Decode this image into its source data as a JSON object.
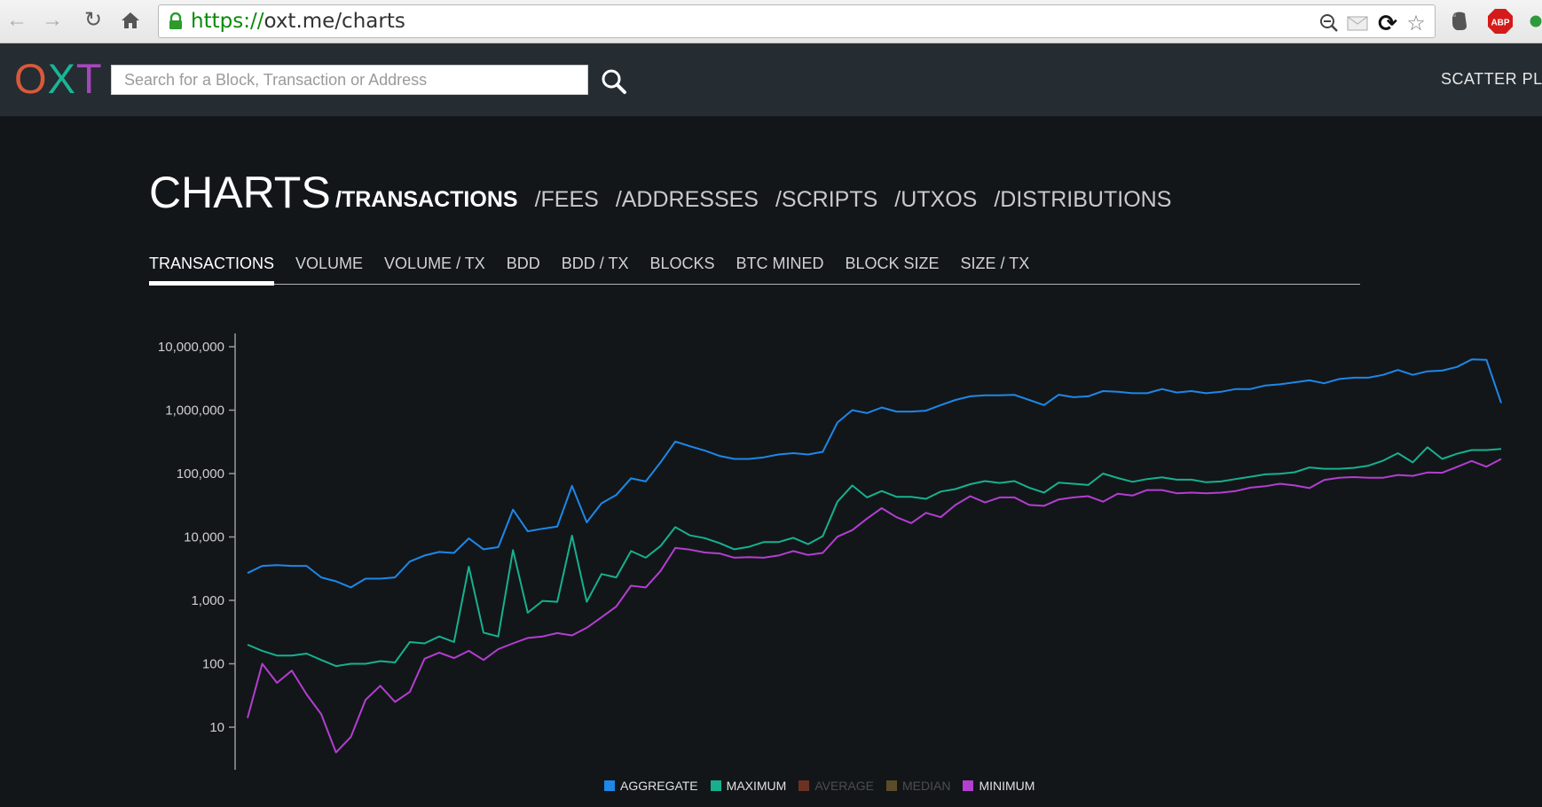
{
  "browser": {
    "url_scheme": "https://",
    "url_rest": "oxt.me/charts"
  },
  "header": {
    "logo": {
      "o": "O",
      "x": "X",
      "t": "T"
    },
    "search_placeholder": "Search for a Block, Transaction or Address",
    "scatter_link": "SCATTER PLO"
  },
  "page": {
    "title": "CHARTS",
    "sections": [
      {
        "label": "/TRANSACTIONS",
        "active": true
      },
      {
        "label": "/FEES",
        "active": false
      },
      {
        "label": "/ADDRESSES",
        "active": false
      },
      {
        "label": "/SCRIPTS",
        "active": false
      },
      {
        "label": "/UTXOS",
        "active": false
      },
      {
        "label": "/DISTRIBUTIONS",
        "active": false
      }
    ],
    "tabs": [
      {
        "label": "TRANSACTIONS",
        "active": true
      },
      {
        "label": "VOLUME",
        "active": false
      },
      {
        "label": "VOLUME / TX",
        "active": false
      },
      {
        "label": "BDD",
        "active": false
      },
      {
        "label": "BDD / TX",
        "active": false
      },
      {
        "label": "BLOCKS",
        "active": false
      },
      {
        "label": "BTC MINED",
        "active": false
      },
      {
        "label": "BLOCK SIZE",
        "active": false
      },
      {
        "label": "SIZE / TX",
        "active": false
      }
    ]
  },
  "chart_data": {
    "type": "line",
    "yscale": "log",
    "ylim": [
      4,
      10000000
    ],
    "y_ticks": [
      10000000,
      1000000,
      100000,
      10000,
      1000,
      100,
      10
    ],
    "y_tick_labels": [
      "10,000,000",
      "1,000,000",
      "100,000",
      "10,000",
      "1,000",
      "100",
      "10"
    ],
    "legend_position": "bottom-center",
    "series": [
      {
        "name": "AGGREGATE",
        "color": "#1e87e8",
        "enabled": true,
        "values": [
          2700,
          3500,
          3600,
          3500,
          3500,
          2300,
          2000,
          1600,
          2200,
          2200,
          2300,
          4100,
          5100,
          5800,
          5600,
          9500,
          6400,
          6900,
          27000,
          12300,
          13500,
          14600,
          64000,
          17000,
          34000,
          46000,
          84000,
          75000,
          150000,
          320000,
          270000,
          230000,
          190000,
          170000,
          170000,
          180000,
          200000,
          210000,
          200000,
          220000,
          640000,
          1000000,
          900000,
          1100000,
          950000,
          950000,
          980000,
          1200000,
          1450000,
          1650000,
          1720000,
          1720000,
          1740000,
          1450000,
          1200000,
          1750000,
          1600000,
          1650000,
          2000000,
          1950000,
          1850000,
          1850000,
          2150000,
          1900000,
          2000000,
          1850000,
          1950000,
          2150000,
          2150000,
          2450000,
          2550000,
          2750000,
          2950000,
          2650000,
          3100000,
          3250000,
          3250000,
          3600000,
          4300000,
          3600000,
          4100000,
          4200000,
          4800000,
          6300000,
          6200000,
          1300000
        ]
      },
      {
        "name": "MAXIMUM",
        "color": "#17b08f",
        "enabled": true,
        "values": [
          200,
          160,
          135,
          135,
          145,
          115,
          92,
          100,
          100,
          110,
          105,
          220,
          210,
          270,
          220,
          3400,
          310,
          270,
          6200,
          640,
          980,
          950,
          10500,
          950,
          2600,
          2300,
          6000,
          4700,
          7200,
          14300,
          10600,
          9600,
          8000,
          6400,
          7000,
          8300,
          8300,
          9700,
          7700,
          10300,
          36000,
          65000,
          42000,
          53000,
          43000,
          43000,
          40000,
          52000,
          57000,
          68000,
          76000,
          71000,
          76000,
          60000,
          50000,
          72000,
          69000,
          66000,
          100000,
          85000,
          74000,
          82000,
          87000,
          80000,
          80000,
          73000,
          75000,
          82000,
          89000,
          97000,
          99000,
          105000,
          125000,
          119000,
          119000,
          123000,
          133000,
          160000,
          210000,
          150000,
          260000,
          170000,
          205000,
          235000,
          235000,
          245000
        ]
      },
      {
        "name": "AVERAGE",
        "color": "#6b3224",
        "enabled": false,
        "values": []
      },
      {
        "name": "MEDIAN",
        "color": "#5c4b29",
        "enabled": false,
        "values": []
      },
      {
        "name": "MINIMUM",
        "color": "#b33ed0",
        "enabled": true,
        "values": [
          14,
          100,
          50,
          78,
          33,
          16,
          4,
          7,
          27,
          45,
          25,
          36,
          120,
          150,
          123,
          160,
          115,
          170,
          210,
          255,
          270,
          305,
          280,
          370,
          540,
          800,
          1700,
          1600,
          2900,
          6700,
          6300,
          5700,
          5500,
          4700,
          4800,
          4700,
          5100,
          6000,
          5200,
          5600,
          10100,
          12800,
          19500,
          28500,
          20500,
          16500,
          24000,
          20500,
          32000,
          44000,
          35000,
          42000,
          42000,
          32000,
          31000,
          39000,
          42000,
          44000,
          36000,
          48000,
          45000,
          55000,
          55000,
          49000,
          50000,
          49000,
          50000,
          53000,
          60000,
          63000,
          69000,
          65000,
          59000,
          79000,
          86000,
          88000,
          86000,
          86000,
          95000,
          92000,
          104000,
          103000,
          127000,
          158000,
          128000,
          170000
        ]
      }
    ]
  }
}
